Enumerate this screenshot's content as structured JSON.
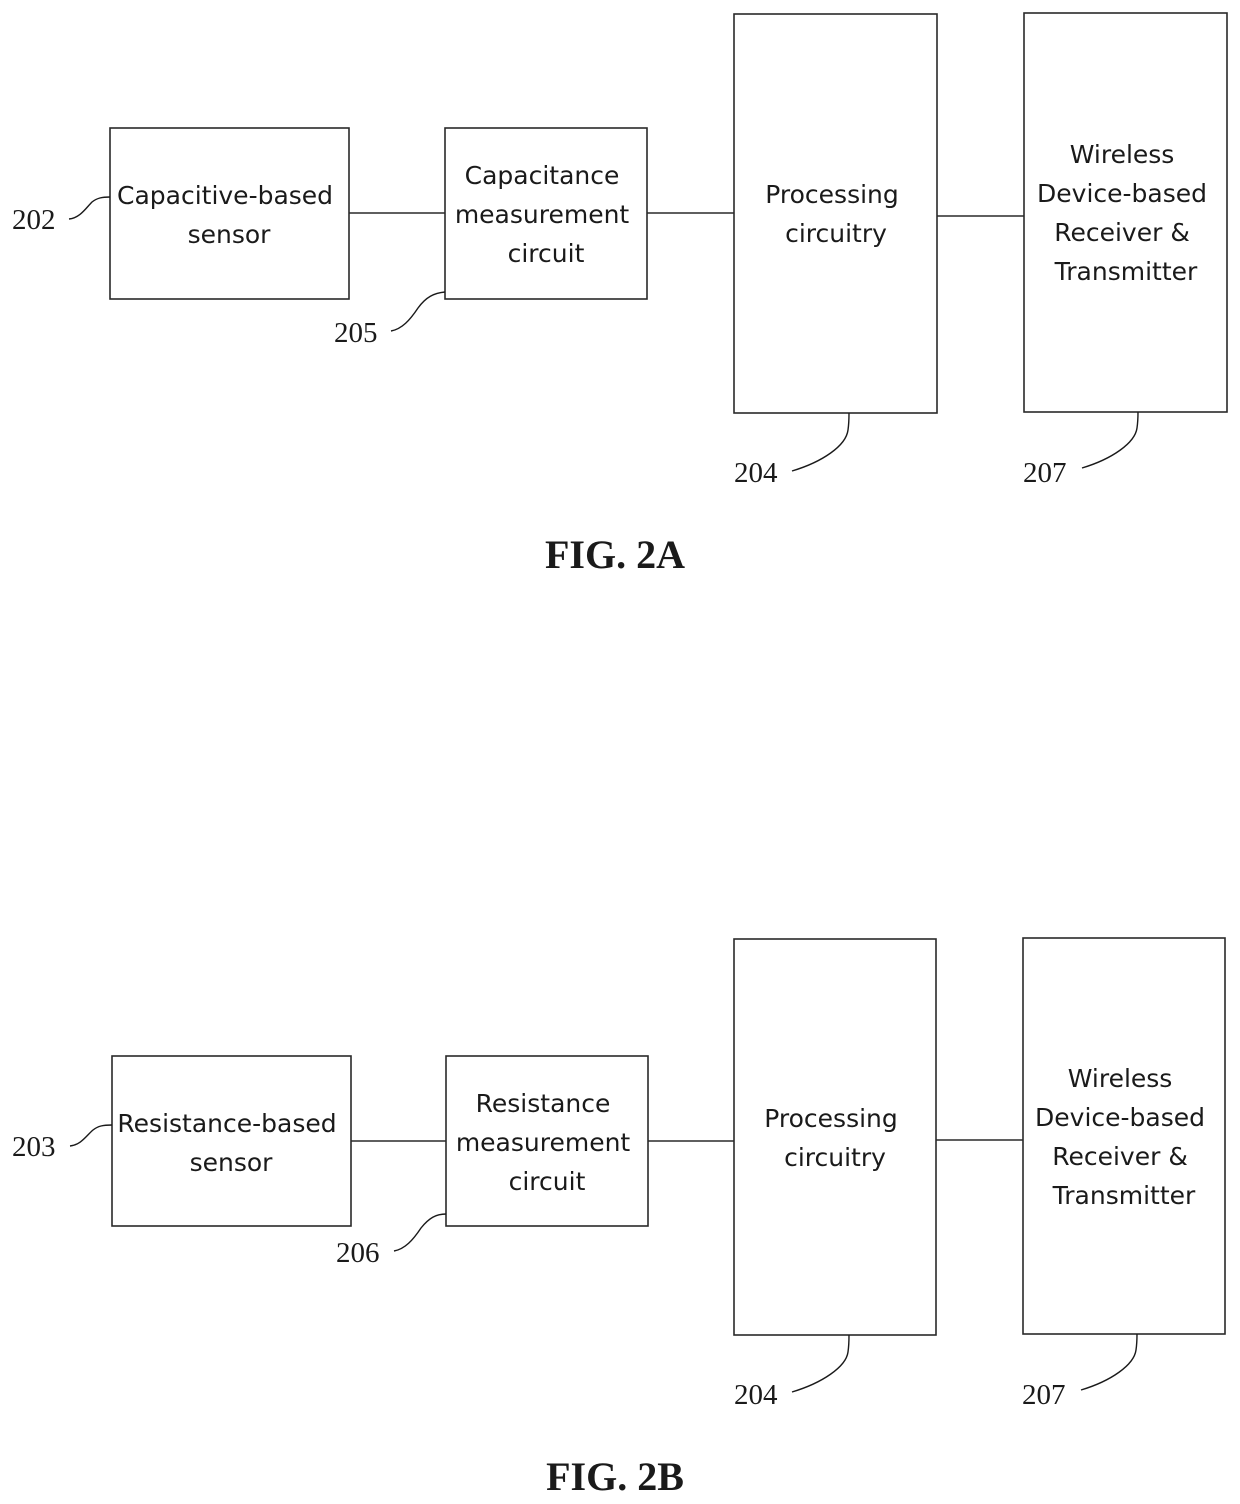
{
  "figures": [
    {
      "caption": "FIG. 2A",
      "blocks": [
        {
          "id": "sensor",
          "ref": "202",
          "lines": [
            "Capacitive-based",
            "sensor"
          ]
        },
        {
          "id": "measurement",
          "ref": "205",
          "lines": [
            "Capacitance",
            "measurement",
            "circuit"
          ]
        },
        {
          "id": "processing",
          "ref": "204",
          "lines": [
            "Processing",
            "circuitry"
          ]
        },
        {
          "id": "wireless",
          "ref": "207",
          "lines": [
            "Wireless",
            "Device-based",
            "Receiver &",
            "Transmitter"
          ]
        }
      ],
      "connections": [
        [
          "sensor",
          "measurement"
        ],
        [
          "measurement",
          "processing"
        ],
        [
          "processing",
          "wireless"
        ]
      ]
    },
    {
      "caption": "FIG. 2B",
      "blocks": [
        {
          "id": "sensor",
          "ref": "203",
          "lines": [
            "Resistance-based",
            "sensor"
          ]
        },
        {
          "id": "measurement",
          "ref": "206",
          "lines": [
            "Resistance",
            "measurement",
            "circuit"
          ]
        },
        {
          "id": "processing",
          "ref": "204",
          "lines": [
            "Processing",
            "circuitry"
          ]
        },
        {
          "id": "wireless",
          "ref": "207",
          "lines": [
            "Wireless",
            "Device-based",
            "Receiver &",
            "Transmitter"
          ]
        }
      ],
      "connections": [
        [
          "sensor",
          "measurement"
        ],
        [
          "measurement",
          "processing"
        ],
        [
          "processing",
          "wireless"
        ]
      ]
    }
  ]
}
